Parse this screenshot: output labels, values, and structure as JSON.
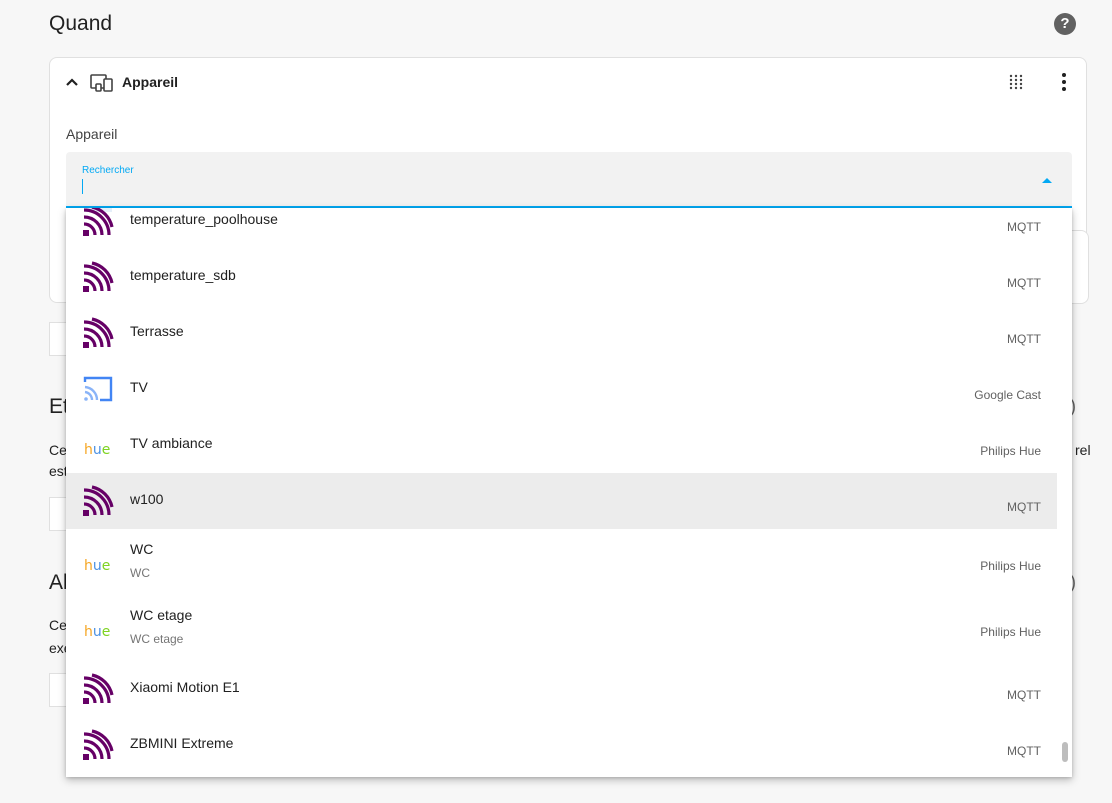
{
  "section": {
    "title": "Quand"
  },
  "card": {
    "title": "Appareil",
    "field_label": "Appareil",
    "search_label": "Rechercher",
    "search_value": ""
  },
  "background": {
    "etat_head": "Et",
    "etat_text_1": "Ce",
    "etat_text_2": "est",
    "etat_trail": "rel",
    "actions_head": "Al",
    "actions_text_1": "Ce",
    "actions_text_2": "exe"
  },
  "devices": [
    {
      "name": "temperature_poolhouse",
      "sub": "",
      "integration": "MQTT",
      "icon": "mqtt-icon"
    },
    {
      "name": "temperature_sdb",
      "sub": "",
      "integration": "MQTT",
      "icon": "mqtt-icon"
    },
    {
      "name": "Terrasse",
      "sub": "",
      "integration": "MQTT",
      "icon": "mqtt-icon"
    },
    {
      "name": "TV",
      "sub": "",
      "integration": "Google Cast",
      "icon": "cast-icon"
    },
    {
      "name": "TV ambiance",
      "sub": "",
      "integration": "Philips Hue",
      "icon": "hue-icon"
    },
    {
      "name": "w100",
      "sub": "",
      "integration": "MQTT",
      "icon": "mqtt-icon"
    },
    {
      "name": "WC",
      "sub": "WC",
      "integration": "Philips Hue",
      "icon": "hue-icon"
    },
    {
      "name": "WC etage",
      "sub": "WC etage",
      "integration": "Philips Hue",
      "icon": "hue-icon"
    },
    {
      "name": "Xiaomi Motion E1",
      "sub": "",
      "integration": "MQTT",
      "icon": "mqtt-icon"
    },
    {
      "name": "ZBMINI Extreme",
      "sub": "",
      "integration": "MQTT",
      "icon": "mqtt-icon"
    }
  ],
  "hue_logo_text": "hue",
  "colors": {
    "accent": "#03a9f4",
    "mqtt": "#660066",
    "cast": "#4285f4",
    "selected_row": "#ececec"
  }
}
